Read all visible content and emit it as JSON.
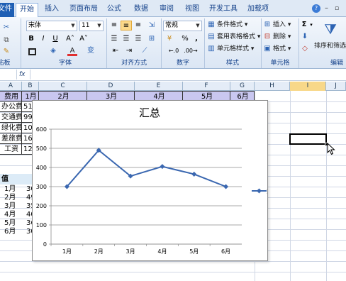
{
  "ribbon_tabs": [
    {
      "label": "文件"
    },
    {
      "label": "开始"
    },
    {
      "label": "插入"
    },
    {
      "label": "页面布局"
    },
    {
      "label": "公式"
    },
    {
      "label": "数据"
    },
    {
      "label": "审阅"
    },
    {
      "label": "视图"
    },
    {
      "label": "开发工具"
    },
    {
      "label": "加载项"
    }
  ],
  "active_tab": "开始",
  "ribbon": {
    "font_name": "宋体",
    "font_size": "11",
    "number_format": "常规",
    "conditional_format": "条件格式",
    "table_format": "套用表格格式",
    "cell_style": "单元格样式",
    "insert": "插入",
    "delete": "删除",
    "format": "格式",
    "sort_filter": "排序和筛选",
    "bold": "B",
    "italic": "I",
    "underline": "U",
    "font_color_glyph": "A",
    "ruby_glyph": "变",
    "percent": "%",
    "comma": ",",
    "sum_glyph": "Σ",
    "groups": {
      "clipboard": "剪贴板",
      "font": "字体",
      "alignment": "对齐方式",
      "number": "数字",
      "styles": "样式",
      "cells": "单元格",
      "editing": "编辑"
    }
  },
  "formula_bar": {
    "fx": "fx",
    "value": ""
  },
  "columns": [
    "A",
    "B",
    "C",
    "D",
    "E",
    "F",
    "G",
    "H",
    "I",
    "J"
  ],
  "selected_column": "I",
  "sheet": {
    "header_row": [
      "费用",
      "1月",
      "2月",
      "3月",
      "4月",
      "5月",
      "6月"
    ],
    "expense_rows": [
      {
        "label": "办公费",
        "b": "51"
      },
      {
        "label": "交通费",
        "b": "99"
      },
      {
        "label": "绿化费",
        "b": "10"
      },
      {
        "label": "差旅费",
        "b": "16"
      },
      {
        "label": "工资",
        "b": "12"
      }
    ],
    "value_header": "值",
    "value_rows": [
      {
        "month": "1月",
        "value": "30"
      },
      {
        "month": "2月",
        "value": "49"
      },
      {
        "month": "3月",
        "value": "35"
      },
      {
        "month": "4月",
        "value": "40"
      },
      {
        "month": "5月",
        "value": "36"
      },
      {
        "month": "6月",
        "value": "30"
      }
    ]
  },
  "chart_data": {
    "type": "line",
    "title": "汇总",
    "categories": [
      "1月",
      "2月",
      "3月",
      "4月",
      "5月",
      "6月"
    ],
    "series": [
      {
        "name": "汇总",
        "values": [
          300,
          490,
          355,
          405,
          365,
          300
        ],
        "color": "#3a67b0"
      }
    ],
    "ylim": [
      0,
      600
    ],
    "yticks": [
      0,
      100,
      200,
      300,
      400,
      500,
      600
    ],
    "grid": true,
    "legend": "right"
  },
  "colors": {
    "ribbon_bg": "#dbe6f4",
    "header_fill": "#c9c7f0",
    "selected_column": "#f8d889",
    "series": "#3a67b0"
  }
}
